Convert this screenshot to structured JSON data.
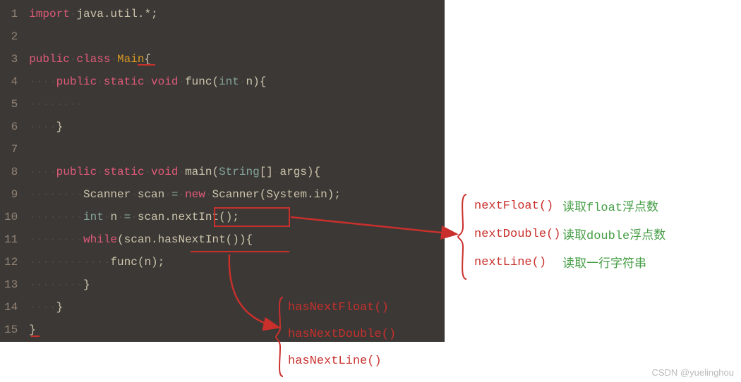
{
  "code": {
    "lines": [
      "1",
      "2",
      "3",
      "4",
      "5",
      "6",
      "7",
      "8",
      "9",
      "10",
      "11",
      "12",
      "13",
      "14",
      "15"
    ],
    "line1": {
      "import": "import",
      "pkg": "java.util.*",
      "semi": ";"
    },
    "line3": {
      "public": "public",
      "class": "class",
      "name": "Main",
      "brace": "{"
    },
    "line4": {
      "public": "public",
      "static": "static",
      "void": "void",
      "func": "func",
      "int": "int",
      "n": "n"
    },
    "line6": {
      "brace": "}"
    },
    "line8": {
      "public": "public",
      "static": "static",
      "void": "void",
      "main": "main",
      "String": "String",
      "args": "args"
    },
    "line9": {
      "Scanner": "Scanner",
      "scan": "scan",
      "new": "new",
      "System": "System",
      "in": "in"
    },
    "line10": {
      "int": "int",
      "n": "n",
      "scan": "scan",
      "nextInt": "nextInt"
    },
    "line11": {
      "while": "while",
      "scan": "scan",
      "hasNextInt": "hasNextInt"
    },
    "line12": {
      "func": "func",
      "n": "n"
    },
    "line13": {
      "brace": "}"
    },
    "line14": {
      "brace": "}"
    },
    "line15": {
      "brace": "}"
    }
  },
  "side": {
    "items": [
      {
        "name": "nextFloat()",
        "desc": "读取float浮点数"
      },
      {
        "name": "nextDouble()",
        "desc": "读取double浮点数"
      },
      {
        "name": "nextLine()",
        "desc": "读取一行字符串"
      }
    ]
  },
  "bottom": {
    "items": [
      "hasNextFloat()",
      "hasNextDouble()",
      "hasNextLine()"
    ]
  },
  "watermark": "CSDN @yuelinghou"
}
